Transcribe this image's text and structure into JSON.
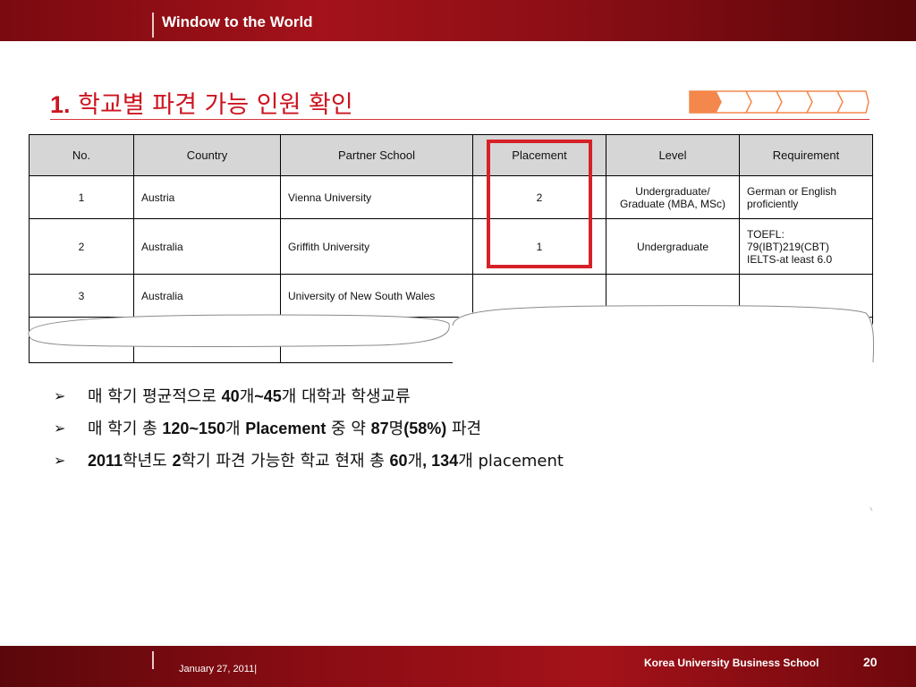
{
  "header": {
    "title": "Window to the World"
  },
  "slide": {
    "heading_number": "1.",
    "heading_text": "학교별 파견 가능 인원 확인"
  },
  "table": {
    "columns": [
      "No.",
      "Country",
      "Partner School",
      "Placement",
      "Level",
      "Requirement"
    ],
    "rows": [
      {
        "no": "1",
        "country": "Austria",
        "school": "Vienna University",
        "placement": "2",
        "level_line1": "Undergraduate/",
        "level_line2": "Graduate (MBA, MSc)",
        "req_line1": "German or English",
        "req_line2": "proficiently",
        "req_line3": ""
      },
      {
        "no": "2",
        "country": "Australia",
        "school": "Griffith University",
        "placement": "1",
        "level_line1": "Undergraduate",
        "level_line2": "",
        "req_line1": "TOEFL:",
        "req_line2": "79(IBT)219(CBT)",
        "req_line3": "IELTS-at least 6.0"
      },
      {
        "no": "3",
        "country": "Australia",
        "school": "University of New South Wales",
        "placement": "",
        "level_line1": "",
        "level_line2": "",
        "req_line1": "",
        "req_line2": "",
        "req_line3": ""
      }
    ]
  },
  "bullets": [
    {
      "arrow": "➢",
      "p1": "매 학기 평균적으로 ",
      "b1": "40",
      "p2": "개",
      "b2": "~45",
      "p3": "개 대학과 학생교류",
      "b3": "",
      "p4": "",
      "b4": "",
      "p5": ""
    },
    {
      "arrow": "➢",
      "p1": "매 학기 총 ",
      "b1": "120~150",
      "p2": "개 ",
      "b2": "Placement",
      "p3": " 중 약 ",
      "b3": "87",
      "p4": "명",
      "b4": "(58%)",
      "p5": " 파견"
    },
    {
      "arrow": "➢",
      "p1": "",
      "b1": "2011",
      "p2": "학년도 ",
      "b2": "2",
      "p3": "학기 파견 가능한 학교 현재 총 ",
      "b3": "60",
      "p4": "개",
      "b4": ", 134",
      "p5": "개 placement"
    }
  ],
  "footer": {
    "date": "January 27, 2011|",
    "school": "Korea University Business School",
    "page": "20"
  },
  "colors": {
    "brand_red": "#a4121a",
    "heading_red": "#cc1520",
    "highlight": "#d62128",
    "progress_active": "#f4874b"
  },
  "progress": {
    "steps": 6,
    "active": 1
  }
}
